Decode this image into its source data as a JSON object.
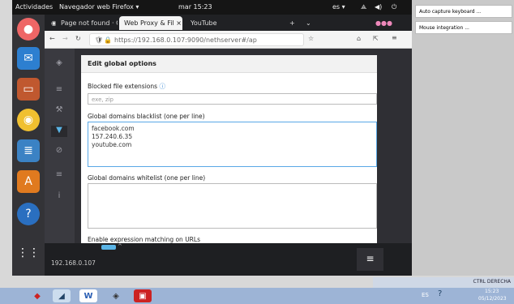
{
  "gnome": {
    "activities": "Actividades",
    "app_name": "Navegador web Firefox ▾",
    "clock": "mar 15:23",
    "lang": "es ▾"
  },
  "browser": {
    "tabs": [
      {
        "label": "Page not found · C ×"
      },
      {
        "label": "Web Proxy & Fil ×"
      },
      {
        "label": "YouTube"
      }
    ],
    "url": "https://192.168.0.107:9090/nethserver#/ap"
  },
  "page": {
    "panel_title": "Edit global options",
    "blocked_ext_label": "Blocked file extensions",
    "blocked_ext_placeholder": "exe, zip",
    "blacklist_label": "Global domains blacklist (one per line)",
    "blacklist_value": "facebook.com\n157.240.6.35\nyoutube.com",
    "whitelist_label": "Global domains whitelist (one per line)",
    "expr_label": "Enable expression matching on URLs",
    "bottom_ip": "192.168.0.107"
  },
  "host_notes": [
    "Auto capture keyboard ...",
    "Mouse integration ..."
  ],
  "host_tray": {
    "text": "CTRL DERECHA",
    "lang": "ES",
    "time": "15:23",
    "date": "05/12/2023"
  }
}
